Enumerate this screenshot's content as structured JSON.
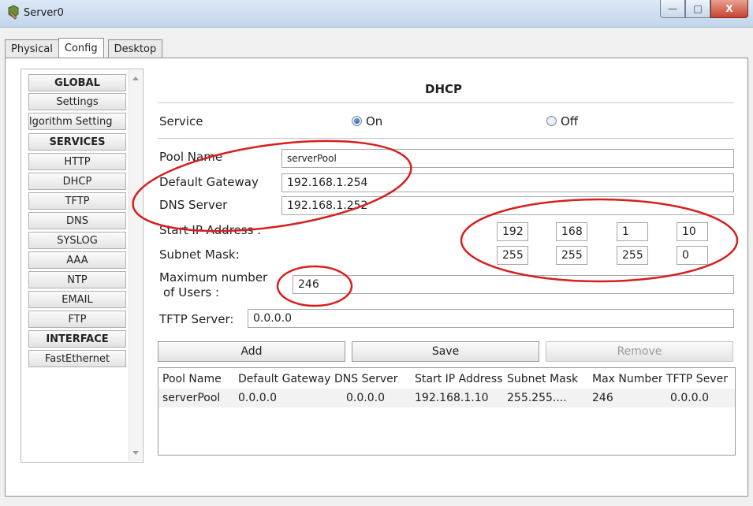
{
  "window": {
    "title": "Server0",
    "controls": {
      "minimize": "—",
      "maximize": "□",
      "close": "X"
    }
  },
  "tabs": [
    "Physical",
    "Config",
    "Desktop"
  ],
  "sidebar": {
    "items": [
      {
        "label": "GLOBAL",
        "header": true
      },
      {
        "label": "Settings"
      },
      {
        "label": "lgorithm Setting"
      },
      {
        "label": "SERVICES",
        "header": true
      },
      {
        "label": "HTTP"
      },
      {
        "label": "DHCP"
      },
      {
        "label": "TFTP"
      },
      {
        "label": "DNS"
      },
      {
        "label": "SYSLOG"
      },
      {
        "label": "AAA"
      },
      {
        "label": "NTP"
      },
      {
        "label": "EMAIL"
      },
      {
        "label": "FTP"
      },
      {
        "label": "INTERFACE",
        "header": true
      },
      {
        "label": "FastEthernet"
      }
    ]
  },
  "dhcp": {
    "heading": "DHCP",
    "service_label": "Service",
    "on_label": "On",
    "off_label": "Off",
    "service_on": true,
    "pool_name_label": "Pool Name",
    "pool_name_value": "serverPool",
    "default_gateway_label": "Default Gateway",
    "default_gateway_value": "192.168.1.254",
    "dns_server_label": "DNS Server",
    "dns_server_value": "192.168.1.252",
    "start_ip_label": "Start IP Address :",
    "start_ip_octets": [
      "192",
      "168",
      "1",
      "10"
    ],
    "subnet_mask_label": "Subnet Mask:",
    "subnet_octets": [
      "255",
      "255",
      "255",
      "0"
    ],
    "max_users_label_line1": "Maximum number",
    "max_users_label_line2": "of Users :",
    "max_users_value": "246",
    "tftp_label": "TFTP Server:",
    "tftp_value": "0.0.0.0",
    "add_label": "Add",
    "save_label": "Save",
    "remove_label": "Remove"
  },
  "pool_table": {
    "columns": [
      "Pool Name",
      "Default Gateway",
      "DNS Server",
      "Start IP Address",
      "Subnet Mask",
      "Max Number",
      "TFTP Sever"
    ],
    "rows": [
      [
        "serverPool",
        "0.0.0.0",
        "0.0.0.0",
        "192.168.1.10",
        "255.255....",
        "246",
        "0.0.0.0"
      ]
    ]
  },
  "colors": {
    "annotation": "#d81e1e",
    "accent": "#1a4fa0"
  }
}
